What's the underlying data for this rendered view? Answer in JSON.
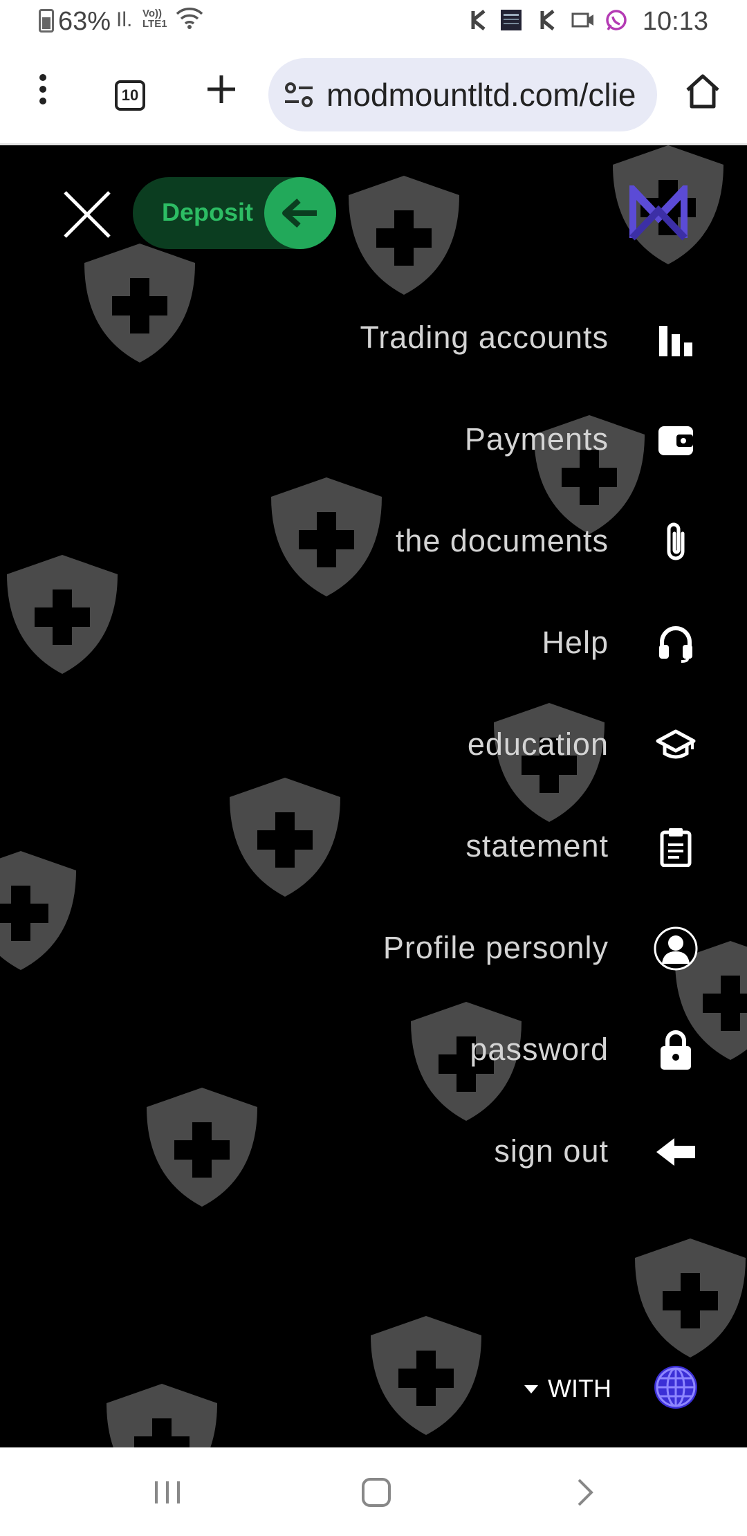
{
  "status_bar": {
    "battery": "63%",
    "signal": "Il.",
    "network_top": "Vo))",
    "network_bottom": "LTE1",
    "time": "10:13",
    "icons": [
      "battery-icon",
      "signal-icon",
      "wifi-icon",
      "k-app-icon",
      "news-app-icon",
      "k-app-icon",
      "missed-call-icon",
      "whatsapp-icon"
    ]
  },
  "browser": {
    "menu_icon": "more-vertical-icon",
    "tab_count": "10",
    "new_tab_icon": "plus-icon",
    "site_settings_icon": "tune-icon",
    "url": "modmountltd.com/clie",
    "home_icon": "home-icon"
  },
  "menu": {
    "close_icon": "close-icon",
    "deposit_label": "Deposit",
    "deposit_icon": "arrow-left-icon",
    "logo": "M",
    "items": [
      {
        "label": "Trading accounts",
        "icon": "bar-chart-icon"
      },
      {
        "label": "Payments",
        "icon": "wallet-icon"
      },
      {
        "label": "the documents",
        "icon": "paperclip-icon"
      },
      {
        "label": "Help",
        "icon": "headset-icon"
      },
      {
        "label": "education",
        "icon": "graduation-cap-icon"
      },
      {
        "label": "statement",
        "icon": "clipboard-icon"
      },
      {
        "label": "Profile personly",
        "icon": "user-circle-icon"
      },
      {
        "label": "password",
        "icon": "lock-icon"
      },
      {
        "label": "sign out",
        "icon": "arrow-left-icon"
      }
    ],
    "language": "WITH",
    "language_icon": "globe-icon"
  },
  "nav_bar": {
    "recents_icon": "recents-icon",
    "home_icon": "home-square-icon",
    "back_icon": "chevron-right-icon"
  },
  "colors": {
    "overlay_bg": "#000000",
    "deposit_bg": "#0b3d20",
    "deposit_accent": "#22a95a",
    "logo_accent": "#5b4bd6",
    "menu_text": "#d4d4d4"
  }
}
